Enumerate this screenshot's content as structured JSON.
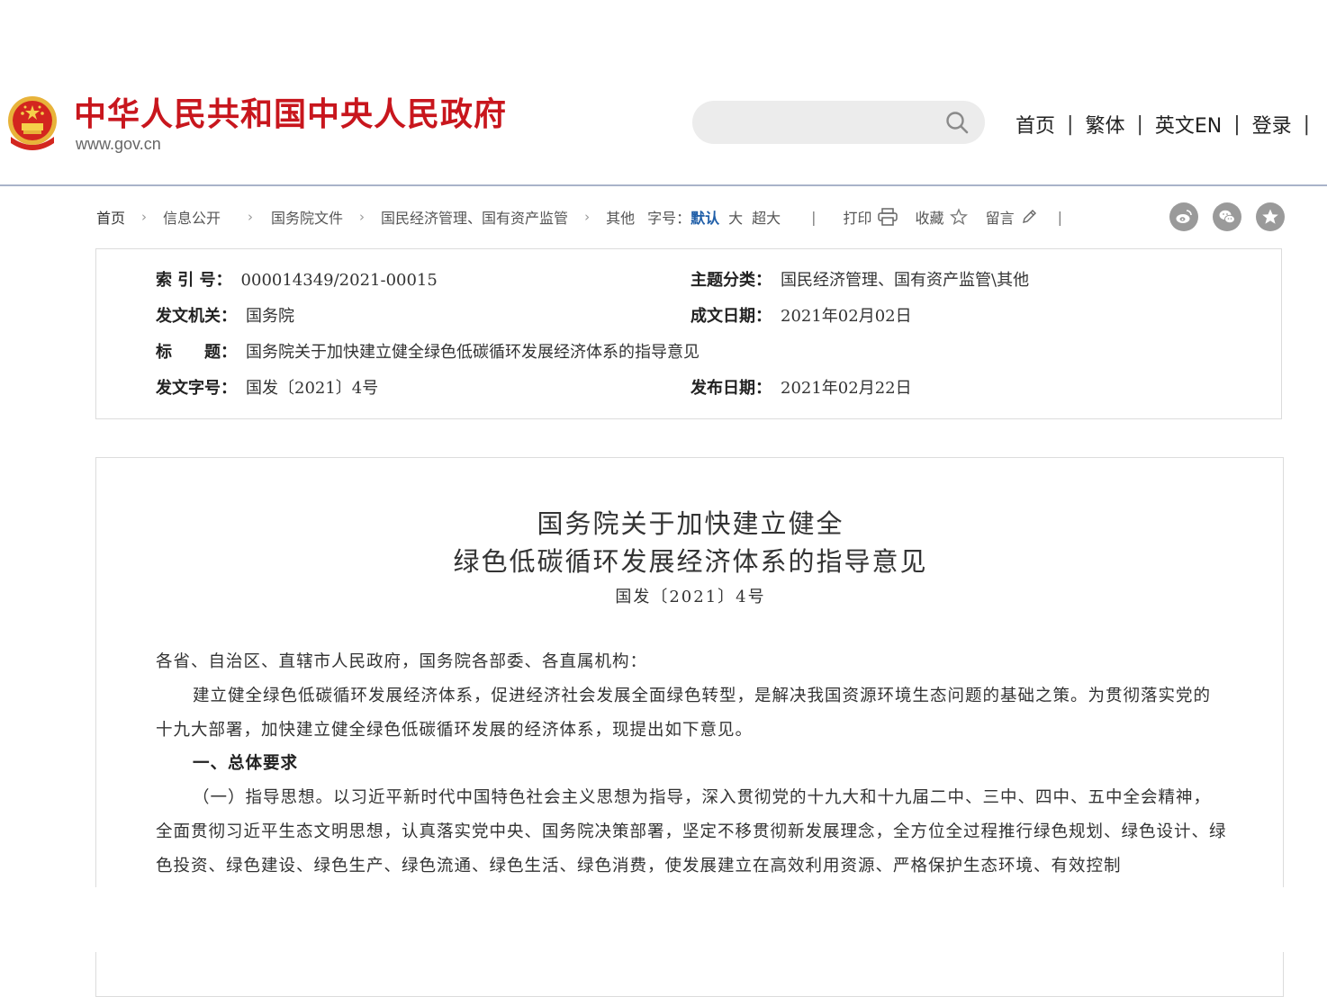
{
  "header": {
    "site_name": "中华人民共和国中央人民政府",
    "site_url": "www.gov.cn",
    "search": {
      "placeholder": "",
      "value": ""
    },
    "nav": [
      "首页",
      "繁体",
      "英文EN",
      "登录"
    ]
  },
  "breadcrumb": {
    "items": [
      "首页",
      "信息公开",
      "国务院文件",
      "国民经济管理、国有资产监管",
      "其他"
    ]
  },
  "toolbar": {
    "font_size_label": "字号：",
    "font_sizes": [
      "默认",
      "大",
      "超大"
    ],
    "active_font_size": "默认",
    "print": "打印",
    "favorite": "收藏",
    "comment": "留言",
    "share_icons": [
      "weibo-icon",
      "wechat-icon",
      "star-icon"
    ]
  },
  "info": {
    "index_label": "索 引 号：",
    "index_value": "000014349/2021-00015",
    "topic_label": "主题分类：",
    "topic_value": "国民经济管理、国有资产监管\\其他",
    "issuer_label": "发文机关：",
    "issuer_value": "国务院",
    "written_date_label": "成文日期：",
    "written_date_value": "2021年02月02日",
    "title_label": "标　　题：",
    "title_value": "国务院关于加快建立健全绿色低碳循环发展经济体系的指导意见",
    "doc_no_label": "发文字号：",
    "doc_no_value": "国发〔2021〕4号",
    "publish_date_label": "发布日期：",
    "publish_date_value": "2021年02月22日"
  },
  "document": {
    "title_line1": "国务院关于加快建立健全",
    "title_line2": "绿色低碳循环发展经济体系的指导意见",
    "number": "国发〔2021〕4号",
    "salutation": "各省、自治区、直辖市人民政府，国务院各部委、各直属机构：",
    "intro": "建立健全绿色低碳循环发展经济体系，促进经济社会发展全面绿色转型，是解决我国资源环境生态问题的基础之策。为贯彻落实党的十九大部署，加快建立健全绿色低碳循环发展的经济体系，现提出如下意见。",
    "section1_heading": "一、总体要求",
    "section1_para1": "（一）指导思想。以习近平新时代中国特色社会主义思想为指导，深入贯彻党的十九大和十九届二中、三中、四中、五中全会精神，全面贯彻习近平生态文明思想，认真落实党中央、国务院决策部署，坚定不移贯彻新发展理念，全方位全过程推行绿色规划、绿色设计、绿色投资、绿色建设、绿色生产、绿色流通、绿色生活、绿色消费，使发展建立在高效利用资源、严格保护生态环境、有效控制"
  },
  "colors": {
    "brand_red": "#c8161d",
    "header_rule": "#a9b3c9",
    "active_link": "#1f5ea8",
    "share_gray": "#9a9a9a"
  }
}
